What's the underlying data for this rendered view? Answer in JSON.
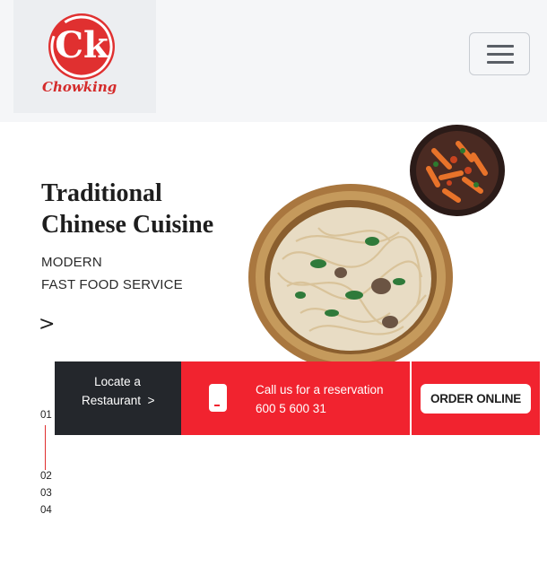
{
  "brand": {
    "logo_initials": "Ck",
    "logo_name": "Chowking"
  },
  "nav": {
    "menu_icon": "hamburger-menu-icon"
  },
  "hero": {
    "title_line1": "Traditional",
    "title_line2": "Chinese Cuisine",
    "subtitle_line1": "MODERN",
    "subtitle_line2": "FAST FOOD SERVICE",
    "arrow": ">"
  },
  "actions": {
    "locate_line1": "Locate a",
    "locate_line2": "Restaurant",
    "locate_arrow": ">",
    "call_label": "Call us for a reservation",
    "call_number": "600 5 600 31",
    "order_label": "ORDER ONLINE"
  },
  "pager": {
    "items": [
      "01",
      "02",
      "03",
      "04"
    ],
    "active": "01"
  },
  "colors": {
    "accent_red": "#f1232f",
    "dark": "#24272c",
    "logo_red": "#e03030"
  }
}
